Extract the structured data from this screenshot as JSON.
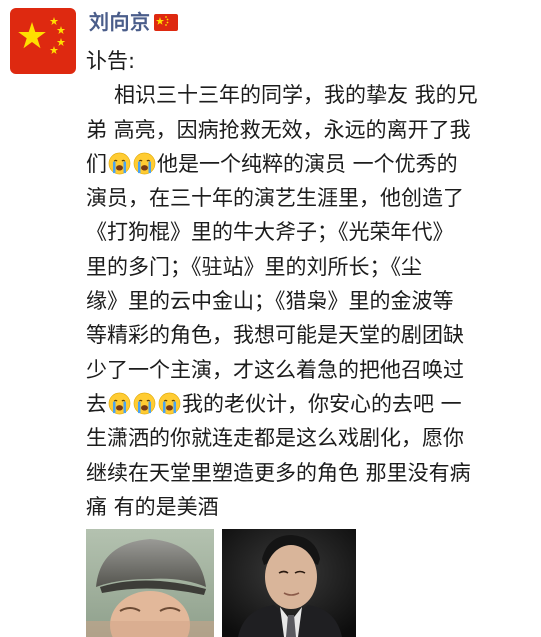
{
  "post": {
    "author": {
      "name": "刘向京",
      "avatar_icon": "china-flag-avatar",
      "badge_icon": "china-flag-emoji"
    },
    "text_segments": [
      {
        "type": "text",
        "value": "讣告:"
      },
      {
        "type": "text",
        "value": "相识三十三年的同学，我的挚友 我的兄"
      },
      {
        "type": "text",
        "value": "弟 高亮，因病抢救无效，永远的离开了我"
      },
      {
        "type": "text",
        "value": "们"
      },
      {
        "type": "emoji",
        "icon": "crying-face-icon"
      },
      {
        "type": "emoji",
        "icon": "crying-face-icon"
      },
      {
        "type": "text",
        "value": "他是一个纯粹的演员 一个优秀的"
      },
      {
        "type": "text",
        "value": "演员，在三十年的演艺生涯里，他创造了"
      },
      {
        "type": "text",
        "value": "《打狗棍》里的牛大斧子；《光荣年代》"
      },
      {
        "type": "text",
        "value": "里的多门；《驻站》里的刘所长；《尘"
      },
      {
        "type": "text",
        "value": "缘》里的云中金山；《猎枭》里的金波等"
      },
      {
        "type": "text",
        "value": "等精彩的角色，我想可能是天堂的剧团缺"
      },
      {
        "type": "text",
        "value": "少了一个主演，才这么着急的把他召唤过"
      },
      {
        "type": "text",
        "value": "去"
      },
      {
        "type": "emoji",
        "icon": "crying-face-icon"
      },
      {
        "type": "emoji",
        "icon": "crying-face-icon"
      },
      {
        "type": "emoji",
        "icon": "crying-face-icon"
      },
      {
        "type": "text",
        "value": "我的老伙计，你安心的去吧 一"
      },
      {
        "type": "text",
        "value": "生潇洒的你就连走都是这么戏剧化，愿你"
      },
      {
        "type": "text",
        "value": "继续在天堂里塑造更多的角色 那里没有病"
      },
      {
        "type": "text",
        "value": "痛 有的是美酒"
      }
    ],
    "photos": [
      {
        "icon": "man-in-flat-cap-photo"
      },
      {
        "icon": "man-in-suit-portrait-photo"
      }
    ],
    "colors": {
      "author_name": "#4a5d8a",
      "flag_red": "#de2910",
      "flag_star": "#ffde00",
      "text": "#1c1c1c"
    }
  }
}
